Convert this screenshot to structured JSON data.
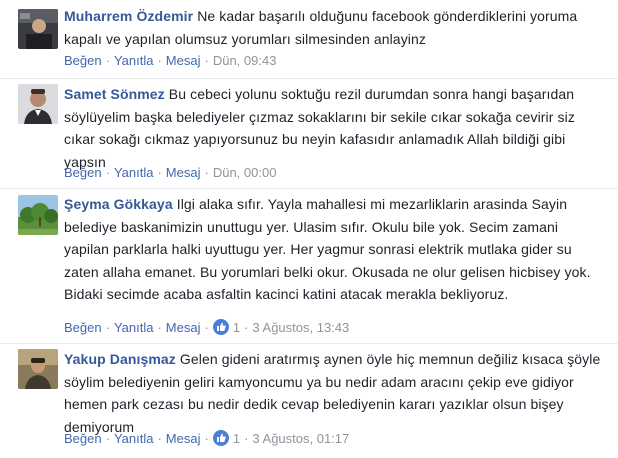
{
  "actions": {
    "like": "Beğen",
    "reply": "Yanıtla",
    "message": "Mesaj",
    "separator": "·"
  },
  "comments": [
    {
      "author": "Muharrem Özdemir",
      "text": "Ne kadar başarılı olduğunu facebook gönderdiklerini yoruma kapalı ve yapılan olumsuz yorumları silmesinden anlayinz",
      "time": "Dün, 09:43",
      "likes": null
    },
    {
      "author": "Samet Sönmez",
      "text": "Bu cebeci yolunu soktuğu rezil durumdan sonra hangi başarıdan söylüyelim başka belediyeler çızmaz sokaklarını bir sekile cıkar sokağa cevirir siz cıkar sokağı cıkmaz yapıyorsunuz bu neyin kafasıdır anlamadık Allah bildiği gibi yapsın",
      "time": "Dün, 00:00",
      "likes": null
    },
    {
      "author": "Şeyma Gökkaya",
      "text": "Ilgi alaka sıfır. Yayla mahallesi mi mezarliklarin arasinda Sayin belediye baskanimizin unuttugu yer. Ulasim sıfır. Okulu bile yok. Secim zamani yapilan parklarla halki uyuttugu yer. Her yagmur sonrasi elektrik mutlaka gider su zaten allaha emanet. Bu yorumlari belki okur. Okusada ne olur gelisen hicbisey yok. Bidaki secimde acaba asfaltin kacinci katini atacak merakla bekliyoruz.",
      "time": "3 Ağustos, 13:43",
      "likes": "1"
    },
    {
      "author": "Yakup Danışmaz",
      "text": "Gelen gideni aratırmış aynen öyle hiç memnun değiliz kısaca şöyle söylim belediyenin geliri kamyoncumu ya bu nedir adam aracını çekip eve gidiyor hemen park cezası bu nedir dedik cevap belediyenin kararı yazıklar olsun bişey demiyorum",
      "time": "3 Ağustos, 01:17",
      "likes": "1"
    }
  ]
}
